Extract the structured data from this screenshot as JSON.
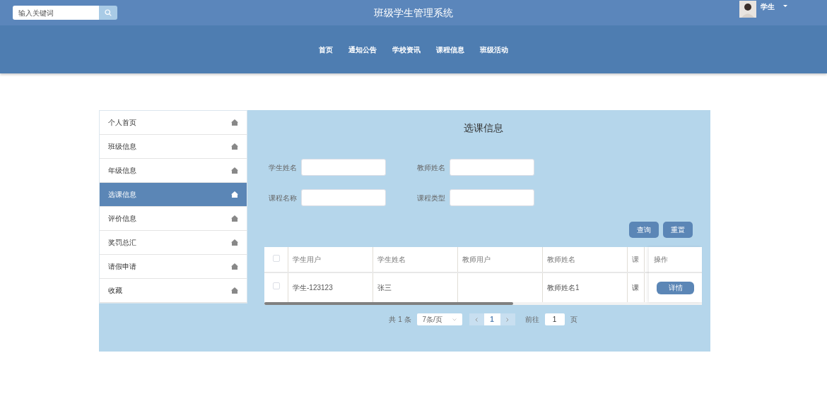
{
  "header": {
    "search": {
      "placeholder": "输入关键词"
    },
    "title": "班级学生管理系统",
    "user": "学生"
  },
  "nav": [
    "首页",
    "通知公告",
    "学校资讯",
    "课程信息",
    "班级活动"
  ],
  "sidebar": {
    "items": [
      {
        "label": "个人首页",
        "selected": false
      },
      {
        "label": "班级信息",
        "selected": false
      },
      {
        "label": "年级信息",
        "selected": false
      },
      {
        "label": "选课信息",
        "selected": true
      },
      {
        "label": "评价信息",
        "selected": false
      },
      {
        "label": "奖罚总汇",
        "selected": false
      },
      {
        "label": "请假申请",
        "selected": false
      },
      {
        "label": "收藏",
        "selected": false
      }
    ]
  },
  "panel": {
    "title": "选课信息",
    "filters": [
      {
        "label": "学生姓名"
      },
      {
        "label": "教师姓名"
      },
      {
        "label": "课程名称"
      },
      {
        "label": "课程类型"
      }
    ],
    "buttons": [
      "查询",
      "重置"
    ],
    "table": {
      "columns": [
        "学生用户",
        "学生姓名",
        "教师用户",
        "教师姓名",
        "课"
      ],
      "action_column": "操作",
      "rows": [
        {
          "checked": false,
          "cells": [
            "学生-123123",
            "张三",
            "",
            "教师姓名1",
            "课"
          ],
          "action": "详情"
        }
      ],
      "header_checked": false
    },
    "pagination": {
      "total": "共 1 条",
      "page_size": "7条/页",
      "page": "1",
      "goto_label": "前往",
      "goto_value": "1",
      "page_suffix": "页"
    }
  }
}
